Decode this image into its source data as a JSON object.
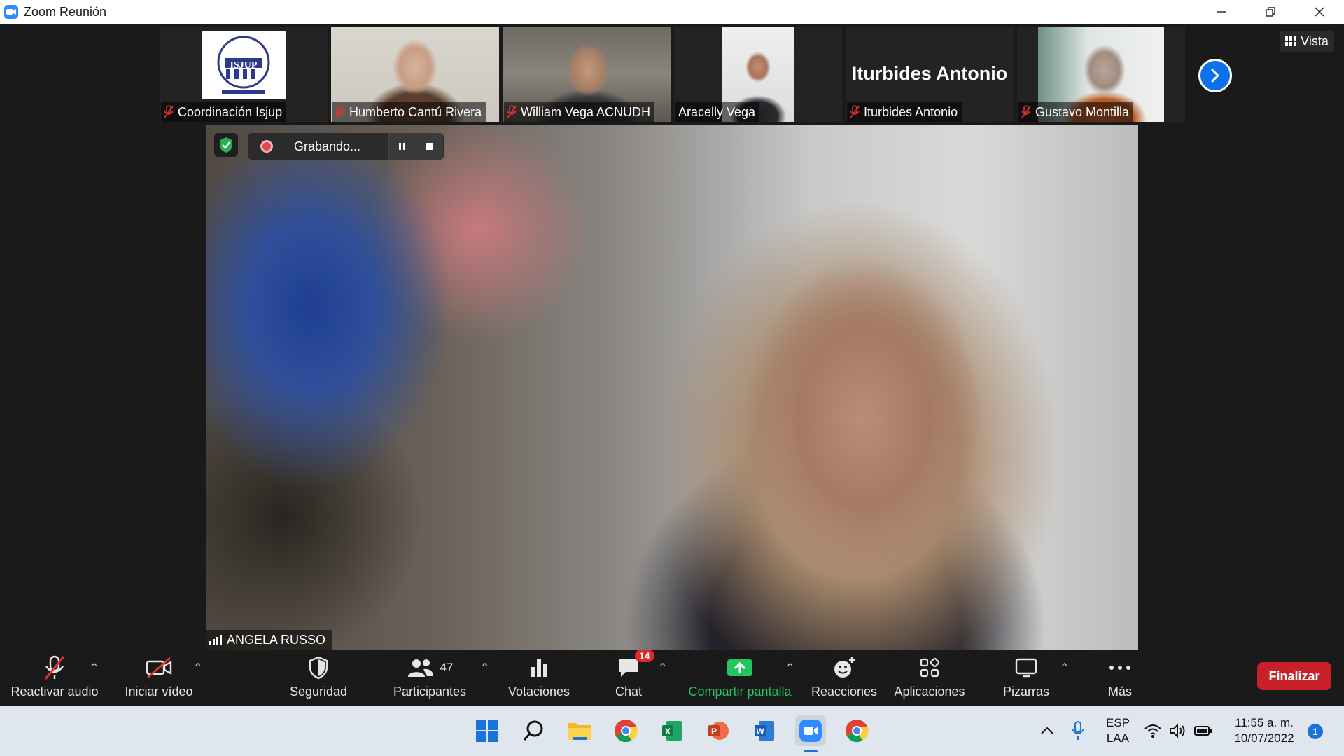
{
  "window": {
    "title": "Zoom Reunión"
  },
  "gallery": {
    "tiles": [
      {
        "name": "Coordinación Isjup",
        "logo_text": "ISJUP"
      },
      {
        "name": "Humberto Cantú Rivera"
      },
      {
        "name": "William Vega ACNUDH"
      },
      {
        "name": "Aracelly Vega"
      },
      {
        "name": "Iturbides Antonio",
        "big_name": "Iturbides Antonio"
      },
      {
        "name": "Gustavo Montilla"
      }
    ],
    "view_label": "Vista"
  },
  "recording": {
    "label": "Grabando..."
  },
  "speaker": {
    "name": "ANGELA RUSSO"
  },
  "toolbar": {
    "audio": "Reactivar audio",
    "video": "Iniciar vídeo",
    "security": "Seguridad",
    "participants": "Participantes",
    "participants_count": "47",
    "polls": "Votaciones",
    "chat": "Chat",
    "chat_badge": "14",
    "share": "Compartir pantalla",
    "reactions": "Reacciones",
    "apps": "Aplicaciones",
    "whiteboards": "Pizarras",
    "more": "Más",
    "end": "Finalizar"
  },
  "taskbar": {
    "lang_top": "ESP",
    "lang_bottom": "LAA",
    "time": "11:55 a. m.",
    "date": "10/07/2022",
    "notifications": "1"
  },
  "colors": {
    "accent": "#0e71eb",
    "share_green": "#23c55e",
    "end_red": "#c92129",
    "badge_red": "#e02828"
  }
}
